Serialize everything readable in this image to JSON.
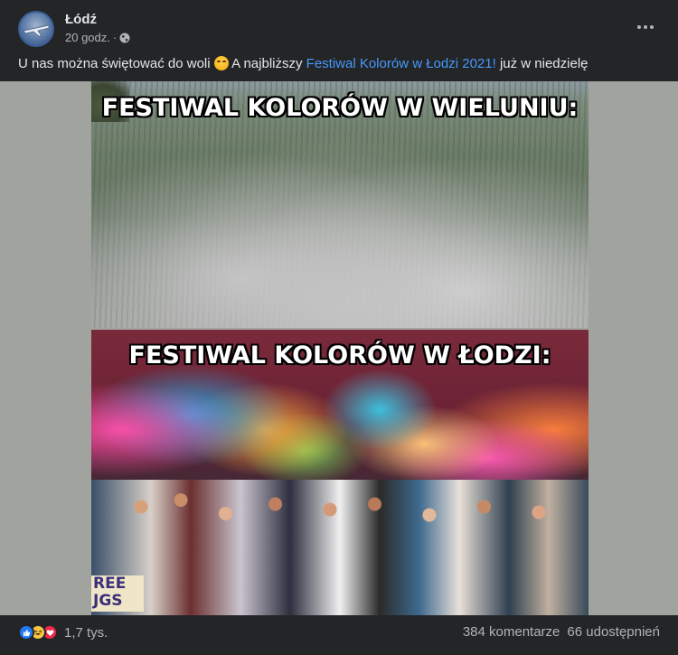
{
  "post": {
    "page_name": "Łódź",
    "time": "20 godz.",
    "separator": "·",
    "audience_icon": "globe-icon",
    "more_icon": "more-options-icon"
  },
  "caption": {
    "text_before": "U nas można świętować do woli",
    "emoji": "smirking-face-emoji",
    "text_middle": "A najbliższy",
    "link_text": "Festiwal Kolorów w Łodzi 2021!",
    "text_after": "już w niedzielę"
  },
  "media": {
    "top_caption": "FESTIWAL KOLORÓW W WIELUNIU:",
    "bottom_caption": "FESTIWAL KOLORÓW W ŁODZI:",
    "sign_text_line1": "REE",
    "sign_text_line2": "JGS"
  },
  "footer": {
    "reaction_icons": [
      "like-icon",
      "haha-icon",
      "love-icon"
    ],
    "reaction_count": "1,7 tys.",
    "comments": "384 komentarze",
    "shares": "66 udostępnień"
  },
  "colors": {
    "background": "#242526",
    "text_primary": "#e4e6eb",
    "text_secondary": "#b0b3b8",
    "link": "#4599ff",
    "like": "#2078f4",
    "love": "#f0284a",
    "haha": "#f7c846"
  }
}
